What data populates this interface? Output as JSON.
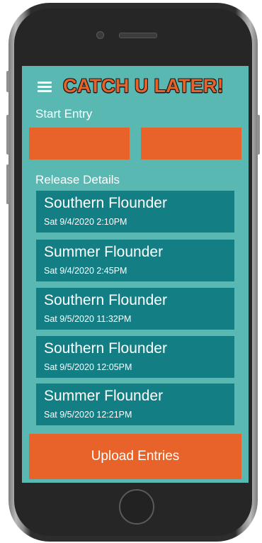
{
  "app": {
    "title": "CATCH U LATER!"
  },
  "header": {
    "menu_icon": "hamburger-menu-icon"
  },
  "start_entry": {
    "label": "Start Entry"
  },
  "release_details": {
    "label": "Release Details",
    "entries": [
      {
        "species": "Southern Flounder",
        "datetime": "Sat 9/4/2020 2:10PM"
      },
      {
        "species": "Summer Flounder",
        "datetime": "Sat 9/4/2020 2:45PM"
      },
      {
        "species": "Southern Flounder",
        "datetime": "Sat 9/5/2020 11:32PM"
      },
      {
        "species": "Southern Flounder",
        "datetime": "Sat 9/5/2020 12:05PM"
      },
      {
        "species": "Summer Flounder",
        "datetime": "Sat 9/5/2020 12:21PM"
      }
    ]
  },
  "upload": {
    "label": "Upload Entries"
  },
  "colors": {
    "screen_background": "#5ab8b3",
    "accent_orange": "#e8632a",
    "entry_teal": "#137f85",
    "text_white": "#ffffff"
  }
}
